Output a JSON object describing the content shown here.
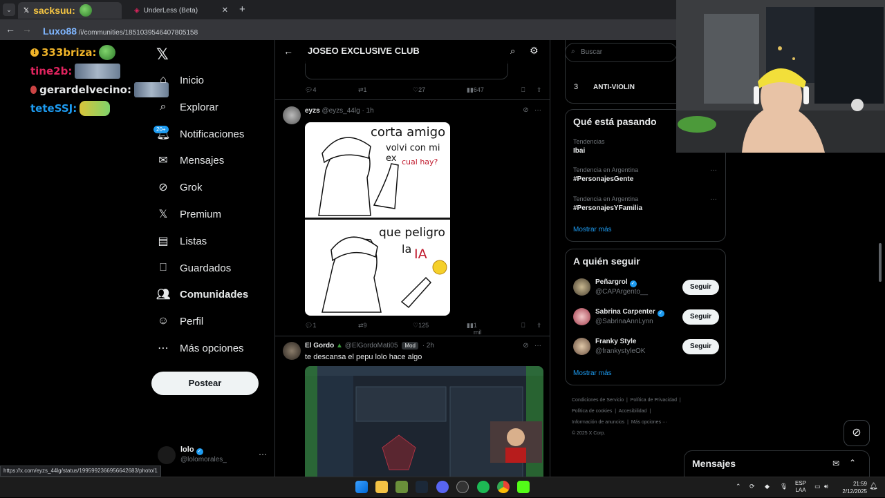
{
  "browser": {
    "tabs": [
      {
        "label": "sacksuu:",
        "favicon": "x-icon"
      },
      {
        "label": "UnderLess (Beta)"
      }
    ],
    "url_host": "Luxo88",
    "url_path": "/i/communities/1851039546407805158",
    "status_url": "https://x.com/eyzs_44lg/status/1995992366956642683/photo/1"
  },
  "chat": [
    {
      "user": "333briza:",
      "color": "#f0b429"
    },
    {
      "user": "tine2b:",
      "color": "#e0245e"
    },
    {
      "user": "gerardelvecino:",
      "color": "#e7e9ea"
    },
    {
      "user": "teteSSJ:",
      "color": "#1d9bf0"
    }
  ],
  "nav": {
    "items": [
      {
        "label": "Inicio",
        "icon": "home-icon"
      },
      {
        "label": "Explorar",
        "icon": "search-icon"
      },
      {
        "label": "Notificaciones",
        "icon": "bell-icon"
      },
      {
        "label": "Mensajes",
        "icon": "mail-icon"
      },
      {
        "label": "Grok",
        "icon": "grok-icon"
      },
      {
        "label": "Premium",
        "icon": "x-icon"
      },
      {
        "label": "Listas",
        "icon": "list-icon"
      },
      {
        "label": "Guardados",
        "icon": "bookmark-icon"
      },
      {
        "label": "Comunidades",
        "icon": "communities-icon"
      },
      {
        "label": "Perfil",
        "icon": "user-icon"
      },
      {
        "label": "Más opciones",
        "icon": "more-icon"
      }
    ],
    "notif_badge": "20+",
    "post_label": "Postear",
    "me_name": "lolo",
    "me_handle": "@lolomorales_"
  },
  "community": {
    "title": "JOSEO EXCLUSIVE CLUB"
  },
  "prev_post_actions": {
    "replies": "4",
    "reposts": "1",
    "likes": "27",
    "views": "647"
  },
  "post1": {
    "name": "eyzs",
    "handle": "@eyzs_44lg",
    "time": "· 1h",
    "meme_top_1": "corta amigo",
    "meme_top_2": "volvi con mi ex",
    "meme_top_3": "cual hay?",
    "meme_bottom_1": "que peligro",
    "meme_bottom_2": "la",
    "meme_bottom_3": "IA",
    "replies": "1",
    "reposts": "9",
    "likes": "125",
    "views": "1 mil"
  },
  "post2": {
    "name": "El Gordo",
    "handle": "@ElGordoMati05",
    "badge": "Mod",
    "time": "· 2h",
    "text": "te descansa el pepu lolo hace algo"
  },
  "right": {
    "search_placeholder": "Buscar",
    "top_trend_num": "3",
    "top_trend": "ANTI-VIOLIN",
    "happening_title": "Qué está pasando",
    "trends": [
      {
        "cat": "Tendencias",
        "name": "Ibai"
      },
      {
        "cat": "Tendencia en Argentina",
        "name": "#PersonajesGente"
      },
      {
        "cat": "Tendencia en Argentina",
        "name": "#PersonajesYFamilia"
      }
    ],
    "show_more": "Mostrar más",
    "follow_title": "A quién seguir",
    "follow": [
      {
        "name": "Peñargrol",
        "handle": "@CAPArgento__",
        "btn": "Seguir"
      },
      {
        "name": "Sabrina Carpenter",
        "handle": "@SabrinaAnnLynn",
        "btn": "Seguir"
      },
      {
        "name": "Franky Style",
        "handle": "@frankystyleOK",
        "btn": "Seguir"
      }
    ],
    "footer": [
      "Condiciones de Servicio",
      "Política de Privacidad",
      "Política de cookies",
      "Accesibilidad",
      "Información de anuncios",
      "Más opciones ···",
      "© 2025 X Corp."
    ]
  },
  "messages": {
    "title": "Mensajes"
  },
  "taskbar": {
    "lang1": "ESP",
    "lang2": "LAA",
    "time": "21:59",
    "date": "2/12/2025"
  }
}
